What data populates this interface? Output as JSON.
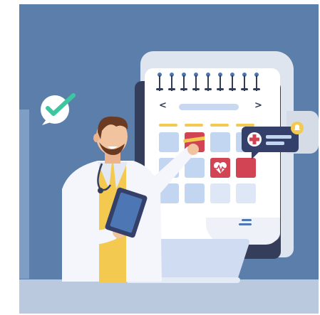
{
  "illustration": {
    "subject": "",
    "colors": {
      "background": "#5c7eaa",
      "floor": "#bac9de",
      "calendar_frame": "#343e5b",
      "calendar_page": "#ffffff",
      "highlight_red": "#d24353",
      "cell_blue": "#c3d6f1",
      "accent_yellow": "#f3c94f",
      "check_green": "#3cc7a0"
    },
    "calendar": {
      "prev_arrow": "<",
      "next_arrow": ">"
    },
    "icons": [
      "check-mark-icon",
      "medical-cross-icon",
      "heart-pulse-icon",
      "bell-icon",
      "pencil-icon",
      "stethoscope-icon",
      "clipboard-icon",
      "laptop-icon"
    ]
  }
}
